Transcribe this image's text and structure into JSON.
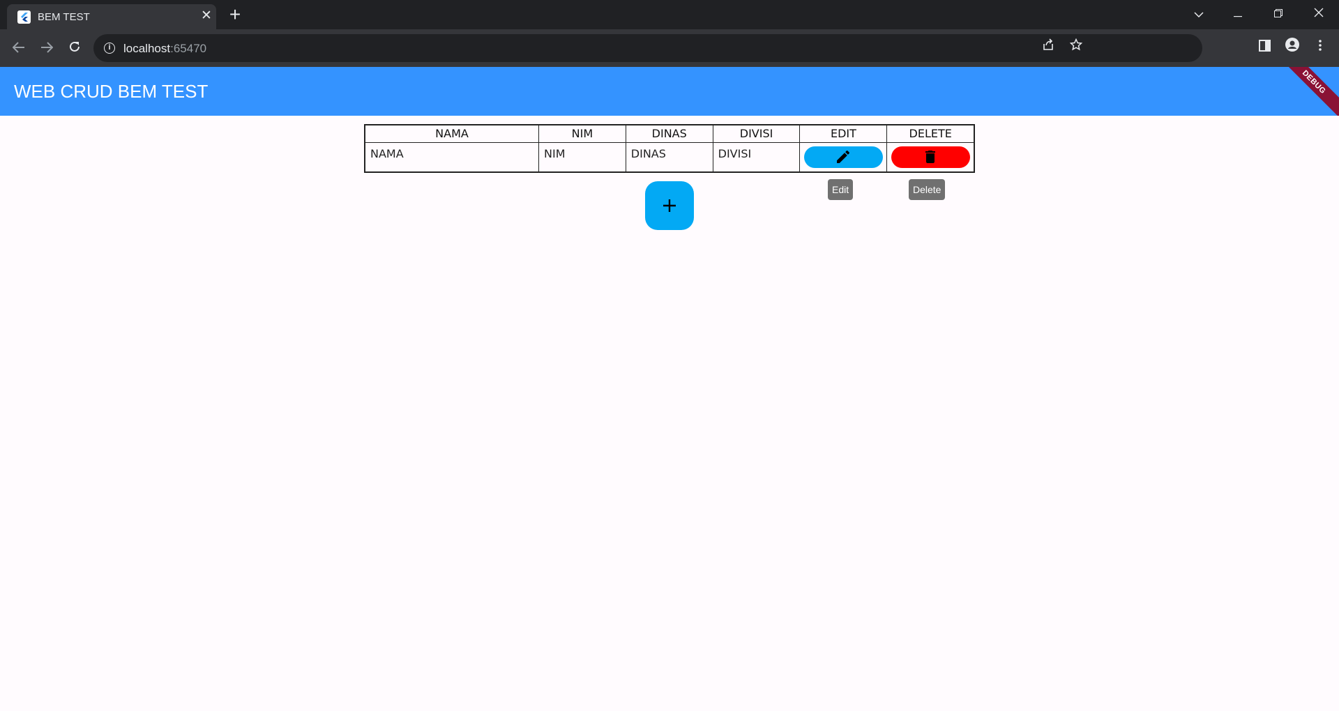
{
  "browser": {
    "tab_title": "BEM TEST",
    "tab_close": "✕",
    "new_tab": "+",
    "url_host": "localhost",
    "url_port": ":65470"
  },
  "app": {
    "title": "WEB CRUD BEM TEST",
    "debug_banner": "DEBUG",
    "accent_color": "#3493ff"
  },
  "table": {
    "headers": [
      "NAMA",
      "NIM",
      "DINAS",
      "DIVISI",
      "EDIT",
      "DELETE"
    ],
    "rows": [
      {
        "nama": "NAMA",
        "nim": "NIM",
        "dinas": "DINAS",
        "divisi": "DIVISI"
      }
    ]
  },
  "tooltips": {
    "edit": "Edit",
    "delete": "Delete"
  },
  "icons": {
    "edit": "pencil-icon",
    "delete": "trash-icon",
    "add": "plus-icon"
  },
  "colors": {
    "edit_button": "#03a9f4",
    "delete_button": "#ff0000",
    "fab": "#03a9f4"
  }
}
